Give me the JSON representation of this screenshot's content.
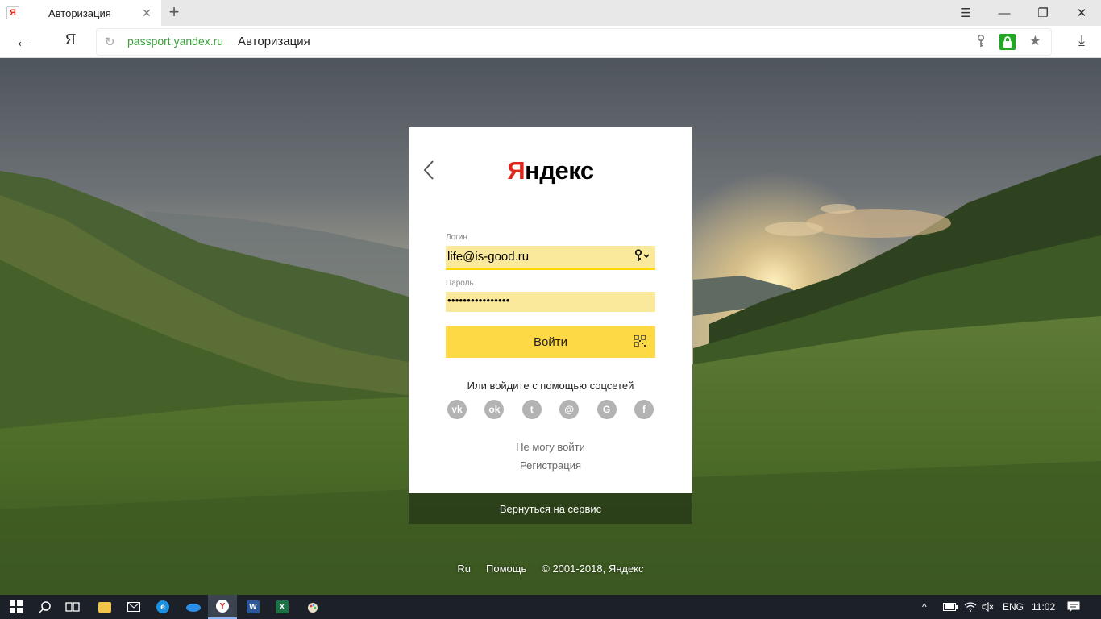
{
  "browser": {
    "tab": {
      "favicon": "Я",
      "title": "Авторизация",
      "close": "✕"
    },
    "new_tab": "+",
    "window_controls": {
      "menu": "☰",
      "minimize": "—",
      "restore": "❐",
      "close": "✕"
    },
    "nav": {
      "back": "←",
      "yandex": "Я"
    },
    "address": {
      "domain": "passport.yandex.ru",
      "page_title": "Авторизация",
      "secure": true
    },
    "download": "⤓"
  },
  "login": {
    "logo_first": "Я",
    "logo_rest": "ндекс",
    "login_label": "Логин",
    "login_value": "life@is-good.ru",
    "password_label": "Пароль",
    "password_value": "••••••••••••••••",
    "submit_label": "Войти",
    "social_title": "Или войдите с помощью соцсетей",
    "social_icons": [
      {
        "name": "vk-icon",
        "glyph": "vk"
      },
      {
        "name": "odnoklassniki-icon",
        "glyph": "ok"
      },
      {
        "name": "twitter-icon",
        "glyph": "t"
      },
      {
        "name": "mail-ru-icon",
        "glyph": "@"
      },
      {
        "name": "google-icon",
        "glyph": "G"
      },
      {
        "name": "facebook-icon",
        "glyph": "f"
      }
    ],
    "cant_login": "Не могу войти",
    "register": "Регистрация",
    "return_service": "Вернуться на сервис"
  },
  "footer": {
    "lang": "Ru",
    "help": "Помощь",
    "copyright": "© 2001-2018, Яндекс"
  },
  "taskbar": {
    "language": "ENG",
    "time": "11:02"
  },
  "colors": {
    "brand_red": "#e0261b",
    "button_yellow": "#fdd945",
    "field_yellow": "#fbe99b",
    "secure_green": "#22a722",
    "url_green": "#3ba33b"
  }
}
